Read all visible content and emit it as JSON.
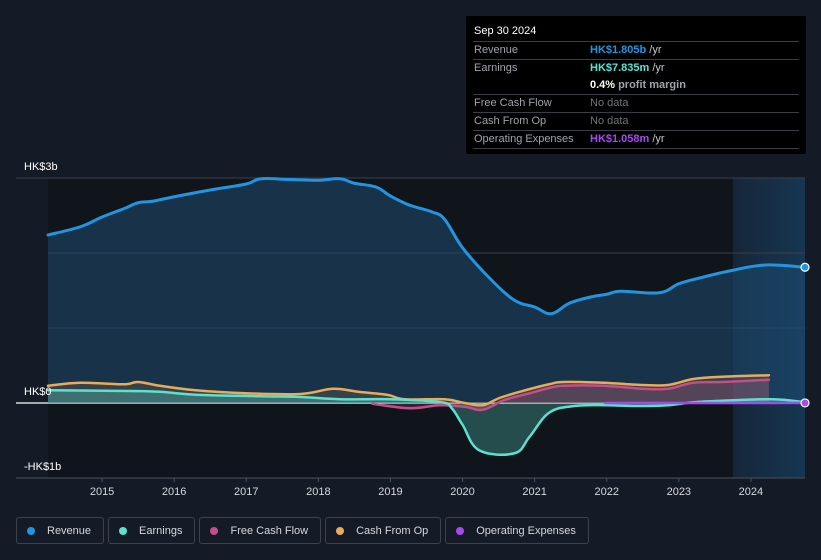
{
  "tooltip": {
    "date": "Sep 30 2024",
    "rows": [
      {
        "label": "Revenue",
        "value": "HK$1.805b",
        "unit": "/yr",
        "color": "#2394df"
      },
      {
        "label": "Earnings",
        "value": "HK$7.835m",
        "unit": "/yr",
        "color": "#5ce1cf"
      },
      {
        "label": "",
        "value": "0.4%",
        "unit": "profit margin",
        "color": "#ffffff"
      },
      {
        "label": "Free Cash Flow",
        "value": "No data",
        "unit": "",
        "color": "#6f757c"
      },
      {
        "label": "Cash From Op",
        "value": "No data",
        "unit": "",
        "color": "#6f757c"
      },
      {
        "label": "Operating Expenses",
        "value": "HK$1.058m",
        "unit": "/yr",
        "color": "#a54bee"
      }
    ]
  },
  "legend": [
    {
      "label": "Revenue",
      "color": "#2394df"
    },
    {
      "label": "Earnings",
      "color": "#5ce1cf"
    },
    {
      "label": "Free Cash Flow",
      "color": "#c64d8a"
    },
    {
      "label": "Cash From Op",
      "color": "#e9aa5a"
    },
    {
      "label": "Operating Expenses",
      "color": "#a54bee"
    }
  ],
  "chart_data": {
    "type": "line",
    "title": "",
    "xlabel": "",
    "ylabel": "",
    "unit": "HK$ billions",
    "ylim": [
      -1,
      3
    ],
    "xlim": [
      2014.25,
      2024.75
    ],
    "y_tick_labels": [
      {
        "value": 3,
        "label": "HK$3b"
      },
      {
        "value": 0,
        "label": "HK$0"
      },
      {
        "value": -1,
        "label": "-HK$1b"
      }
    ],
    "x_tick_labels": [
      "2015",
      "2016",
      "2017",
      "2018",
      "2019",
      "2020",
      "2021",
      "2022",
      "2023",
      "2024"
    ],
    "x_ticks": [
      2015,
      2016,
      2017,
      2018,
      2019,
      2020,
      2021,
      2022,
      2023,
      2024
    ],
    "grid": true,
    "highlight_from": 2023.75,
    "legend_position": "bottom",
    "series": [
      {
        "name": "Revenue",
        "color": "#2394df",
        "fill": true,
        "x": [
          2014.25,
          2014.7,
          2015.0,
          2015.3,
          2015.5,
          2015.7,
          2016.0,
          2016.5,
          2017.0,
          2017.2,
          2017.6,
          2018.0,
          2018.3,
          2018.5,
          2018.8,
          2019.0,
          2019.26,
          2019.57,
          2019.75,
          2020.0,
          2020.37,
          2020.72,
          2021.0,
          2021.23,
          2021.48,
          2021.76,
          2022.0,
          2022.2,
          2022.73,
          2023.0,
          2023.3,
          2023.75,
          2024.2,
          2024.75
        ],
        "values": [
          2.24,
          2.35,
          2.48,
          2.59,
          2.67,
          2.69,
          2.75,
          2.84,
          2.92,
          2.99,
          2.98,
          2.97,
          2.99,
          2.93,
          2.88,
          2.76,
          2.64,
          2.55,
          2.45,
          2.07,
          1.67,
          1.37,
          1.28,
          1.19,
          1.33,
          1.41,
          1.45,
          1.49,
          1.47,
          1.59,
          1.67,
          1.77,
          1.84,
          1.81
        ]
      },
      {
        "name": "Earnings",
        "color": "#5ce1cf",
        "fill": true,
        "x": [
          2014.25,
          2015.4,
          2015.8,
          2016.3,
          2017.2,
          2017.75,
          2018.3,
          2019.0,
          2019.7,
          2019.85,
          2020.0,
          2020.23,
          2020.72,
          2020.93,
          2021.2,
          2021.55,
          2022.0,
          2022.4,
          2022.85,
          2023.2,
          2023.6,
          2024.3,
          2024.75
        ],
        "values": [
          0.17,
          0.16,
          0.15,
          0.11,
          0.09,
          0.08,
          0.05,
          0.05,
          0.01,
          -0.07,
          -0.29,
          -0.63,
          -0.67,
          -0.45,
          -0.13,
          -0.04,
          -0.03,
          -0.04,
          -0.03,
          0.01,
          0.03,
          0.05,
          0.01
        ]
      },
      {
        "name": "Free Cash Flow",
        "color": "#c64d8a",
        "fill": true,
        "x": [
          2018.75,
          2019.27,
          2019.68,
          2020.03,
          2020.28,
          2020.58,
          2020.93,
          2021.2,
          2021.4,
          2021.95,
          2022.5,
          2022.85,
          2023.2,
          2023.6,
          2024.25
        ],
        "values": [
          -0.01,
          -0.07,
          -0.03,
          -0.05,
          -0.09,
          0.04,
          0.13,
          0.2,
          0.23,
          0.23,
          0.19,
          0.19,
          0.27,
          0.28,
          0.31
        ]
      },
      {
        "name": "Cash From Op",
        "color": "#e9aa5a",
        "fill": true,
        "x": [
          2014.25,
          2014.7,
          2015.3,
          2015.5,
          2015.8,
          2016.3,
          2017.0,
          2017.75,
          2018.2,
          2018.55,
          2018.95,
          2019.2,
          2019.75,
          2020.03,
          2020.28,
          2020.52,
          2020.87,
          2021.2,
          2021.4,
          2021.95,
          2022.5,
          2022.85,
          2023.2,
          2023.6,
          2024.25
        ],
        "values": [
          0.23,
          0.27,
          0.25,
          0.28,
          0.23,
          0.17,
          0.13,
          0.12,
          0.19,
          0.15,
          0.11,
          0.05,
          0.05,
          0.0,
          -0.03,
          0.07,
          0.17,
          0.25,
          0.28,
          0.27,
          0.24,
          0.24,
          0.32,
          0.35,
          0.37
        ]
      },
      {
        "name": "Operating Expenses",
        "color": "#a54bee",
        "fill": false,
        "x": [
          2021.98,
          2022.5,
          2023.0,
          2023.5,
          2024.0,
          2024.75
        ],
        "values": [
          0.0,
          0.0,
          0.0,
          0.0,
          0.0,
          0.001
        ]
      }
    ]
  }
}
